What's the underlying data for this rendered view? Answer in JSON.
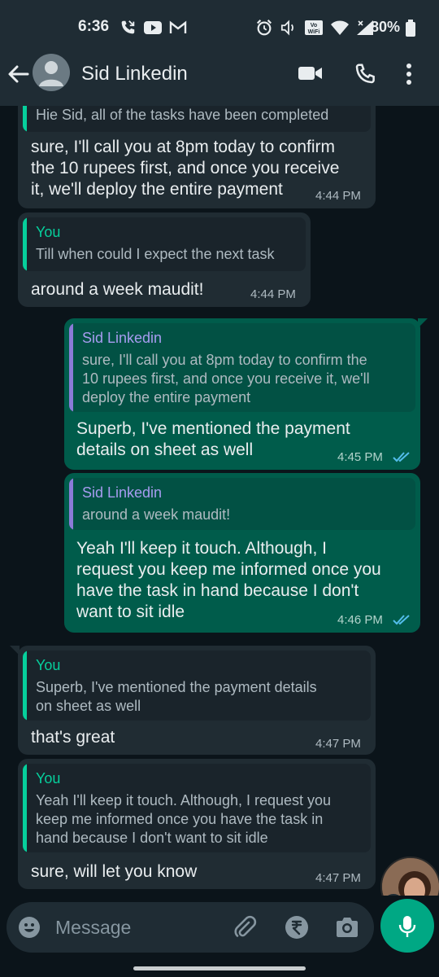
{
  "status": {
    "time": "6:36",
    "battery": "80%",
    "vowifi": "Vo¹ WiFi"
  },
  "header": {
    "contact_name": "Sid Linkedin"
  },
  "messages": [
    {
      "direction": "incoming",
      "quote_text": "Hie Sid, all of the tasks have been completed",
      "text_lines": [
        "sure, I'll call you at 8pm today to confirm",
        "the 10 rupees first, and once you receive",
        "it, we'll deploy the entire payment"
      ],
      "time": "4:44 PM"
    },
    {
      "direction": "incoming",
      "quote_author": "You",
      "quote_text": "Till when could I expect the next task",
      "text_lines": [
        "around a week maudit!"
      ],
      "time": "4:44 PM"
    },
    {
      "direction": "outgoing",
      "quote_author": "Sid Linkedin",
      "quote_lines": [
        "sure, I'll call you at 8pm today to confirm the",
        "10 rupees first, and once you receive it, we'll",
        "deploy the entire payment"
      ],
      "text_lines": [
        "Superb, I've mentioned the payment",
        "details on sheet as well"
      ],
      "time": "4:45 PM"
    },
    {
      "direction": "outgoing",
      "quote_author": "Sid Linkedin",
      "quote_lines": [
        "around a week maudit!"
      ],
      "text_lines": [
        "Yeah I'll keep it touch. Although, I",
        "request you keep me informed once you",
        "have the task in hand because I don't",
        "want to sit idle"
      ],
      "time": "4:46 PM"
    },
    {
      "direction": "incoming",
      "quote_author": "You",
      "quote_lines": [
        "Superb, I've mentioned the payment details",
        "on sheet as well"
      ],
      "text_lines": [
        "that's great"
      ],
      "time": "4:47 PM"
    },
    {
      "direction": "incoming",
      "quote_author": "You",
      "quote_lines": [
        "Yeah I'll keep it touch. Although, I request you",
        "keep me informed once you have the task in",
        "hand because I don't want to sit idle"
      ],
      "text_lines": [
        "sure, will let you know"
      ],
      "time": "4:47 PM"
    }
  ],
  "composer": {
    "placeholder": "Message"
  },
  "colors": {
    "incoming": "#202c33",
    "outgoing": "#005c4b",
    "accent": "#00a884",
    "quote_you": "#06cf9c",
    "quote_contact": "#a79cf0",
    "read_ticks": "#53bdeb"
  }
}
